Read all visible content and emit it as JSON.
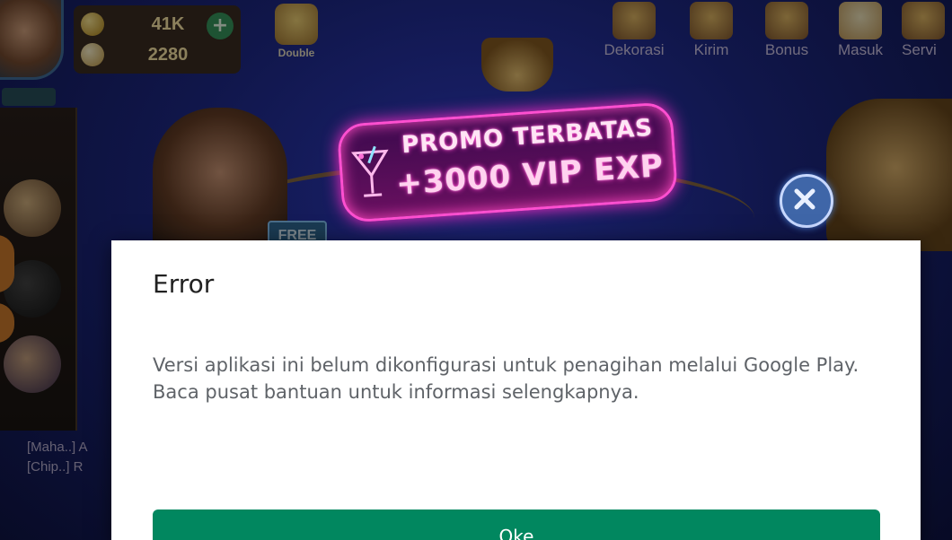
{
  "game": {
    "currency": {
      "coins": "41K",
      "chips": "2280"
    },
    "double_label": "Double",
    "top_nav": [
      {
        "label": "Dekorasi",
        "icon": "decoration-icon"
      },
      {
        "label": "Kirim",
        "icon": "gift-send-icon"
      },
      {
        "label": "Bonus",
        "icon": "bonus-icon"
      },
      {
        "label": "Masuk",
        "icon": "checkin-icon"
      },
      {
        "label": "Servi",
        "icon": "service-icon"
      }
    ],
    "free_tag": "FREE",
    "chat_lines": [
      "[Maha..] A",
      "[Chip..] R"
    ]
  },
  "promo": {
    "line1": "PROMO TERBATAS",
    "line2": "+3000 VIP EXP",
    "accent_color": "#ff4fd0"
  },
  "dialog": {
    "title": "Error",
    "message": "Versi aplikasi ini belum dikonfigurasi untuk penagihan melalui Google Play. Baca pusat bantuan untuk informasi selengkapnya.",
    "ok_label": "Oke",
    "button_color": "#01875f"
  }
}
